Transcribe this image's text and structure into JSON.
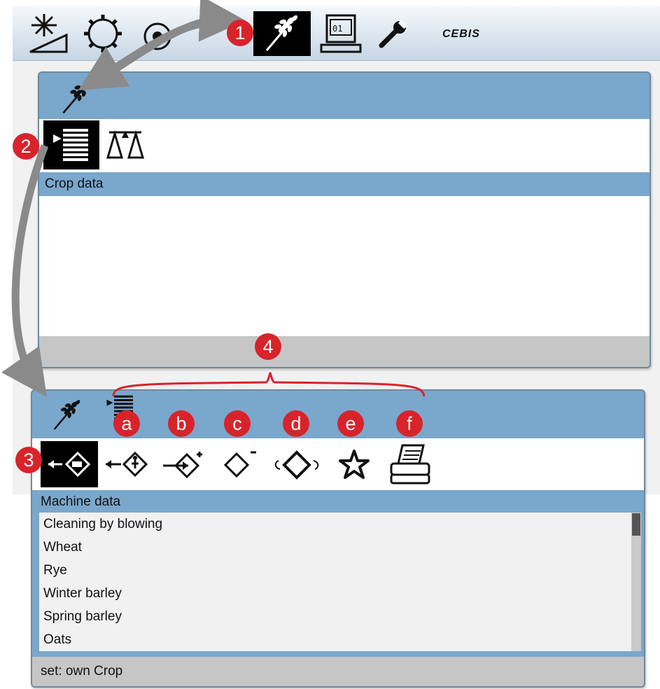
{
  "top_toolbar": {
    "brand": "CEBIS",
    "icons": [
      "threshing-settings-icon",
      "cleaning-fan-icon",
      "rotor-icon",
      "grain-ear-icon",
      "counter-display-icon",
      "wrench-icon"
    ],
    "active_icon": "grain-ear-icon"
  },
  "crop_panel": {
    "tabs": [
      "crop-data-list-icon",
      "weighing-scale-icon"
    ],
    "selected_tab": "crop-data-list-icon",
    "title": "Crop data"
  },
  "machine_panel": {
    "title": "Machine data",
    "toolbar_icons": [
      "load-standard-data-icon",
      "load-customer-data-icon",
      "add-entry-icon",
      "delete-entry-icon",
      "rename-entry-icon",
      "favorite-star-icon",
      "printer-icon"
    ],
    "selected_icon": "load-standard-data-icon",
    "list": [
      "Cleaning by blowing",
      "Wheat",
      "Rye",
      "Winter barley",
      "Spring barley",
      "Oats"
    ],
    "status": "set: own Crop"
  },
  "callouts": [
    "1",
    "2",
    "3",
    "4",
    "a",
    "b",
    "c",
    "d",
    "e",
    "f"
  ],
  "colors": {
    "panel_blue": "#7aa7cc",
    "callout_red": "#d9232b",
    "arrow_grey": "#8a8a8a",
    "selected_black": "#000000"
  }
}
